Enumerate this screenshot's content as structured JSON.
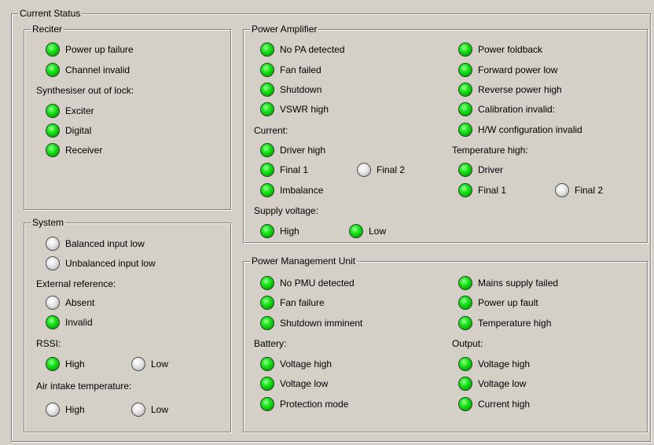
{
  "current_status": {
    "title": "Current Status",
    "reciter": {
      "title": "Reciter",
      "power_up_failure": {
        "label": "Power up failure",
        "state": "on"
      },
      "channel_invalid": {
        "label": "Channel invalid",
        "state": "on"
      },
      "synth_label": "Synthesiser out of lock:",
      "exciter": {
        "label": "Exciter",
        "state": "on"
      },
      "digital": {
        "label": "Digital",
        "state": "on"
      },
      "receiver": {
        "label": "Receiver",
        "state": "on"
      }
    },
    "system": {
      "title": "System",
      "balanced_input_low": {
        "label": "Balanced input low",
        "state": "off"
      },
      "unbalanced_input_low": {
        "label": "Unbalanced input low",
        "state": "off"
      },
      "ext_ref_label": "External reference:",
      "absent": {
        "label": "Absent",
        "state": "off"
      },
      "invalid": {
        "label": "Invalid",
        "state": "on"
      },
      "rssi_label": "RSSI:",
      "rssi_high": {
        "label": "High",
        "state": "on"
      },
      "rssi_low": {
        "label": "Low",
        "state": "off"
      },
      "air_label": "Air intake temperature:",
      "air_high": {
        "label": "High",
        "state": "off"
      },
      "air_low": {
        "label": "Low",
        "state": "off"
      }
    },
    "power_amplifier": {
      "title": "Power Amplifier",
      "no_pa_detected": {
        "label": "No PA detected",
        "state": "on"
      },
      "fan_failed": {
        "label": "Fan failed",
        "state": "on"
      },
      "shutdown": {
        "label": "Shutdown",
        "state": "on"
      },
      "vswr_high": {
        "label": "VSWR high",
        "state": "on"
      },
      "current_label": "Current:",
      "driver_high": {
        "label": "Driver high",
        "state": "on"
      },
      "final1": {
        "label": "Final 1",
        "state": "on"
      },
      "final2": {
        "label": "Final 2",
        "state": "off"
      },
      "imbalance": {
        "label": "Imbalance",
        "state": "on"
      },
      "supply_label": "Supply voltage:",
      "supply_high": {
        "label": "High",
        "state": "on"
      },
      "supply_low": {
        "label": "Low",
        "state": "on"
      },
      "power_foldback": {
        "label": "Power foldback",
        "state": "on"
      },
      "forward_power_low": {
        "label": "Forward power low",
        "state": "on"
      },
      "reverse_power_high": {
        "label": "Reverse power high",
        "state": "on"
      },
      "calibration_invalid": {
        "label": "Calibration invalid:",
        "state": "on"
      },
      "hw_config_invalid": {
        "label": "H/W configuration invalid",
        "state": "on"
      },
      "temp_label": "Temperature high:",
      "temp_driver": {
        "label": "Driver",
        "state": "on"
      },
      "temp_final1": {
        "label": "Final 1",
        "state": "on"
      },
      "temp_final2": {
        "label": "Final 2",
        "state": "off"
      }
    },
    "pmu": {
      "title": "Power Management Unit",
      "no_pmu_detected": {
        "label": "No PMU detected",
        "state": "on"
      },
      "fan_failure": {
        "label": "Fan failure",
        "state": "on"
      },
      "shutdown_imminent": {
        "label": "Shutdown imminent",
        "state": "on"
      },
      "battery_label": "Battery:",
      "bat_voltage_high": {
        "label": "Voltage high",
        "state": "on"
      },
      "bat_voltage_low": {
        "label": "Voltage low",
        "state": "on"
      },
      "protection_mode": {
        "label": "Protection mode",
        "state": "on"
      },
      "mains_supply_failed": {
        "label": "Mains supply failed",
        "state": "on"
      },
      "power_up_fault": {
        "label": "Power up fault",
        "state": "on"
      },
      "temperature_high": {
        "label": "Temperature high",
        "state": "on"
      },
      "output_label": "Output:",
      "out_voltage_high": {
        "label": "Voltage high",
        "state": "on"
      },
      "out_voltage_low": {
        "label": "Voltage low",
        "state": "on"
      },
      "current_high": {
        "label": "Current high",
        "state": "on"
      }
    }
  }
}
